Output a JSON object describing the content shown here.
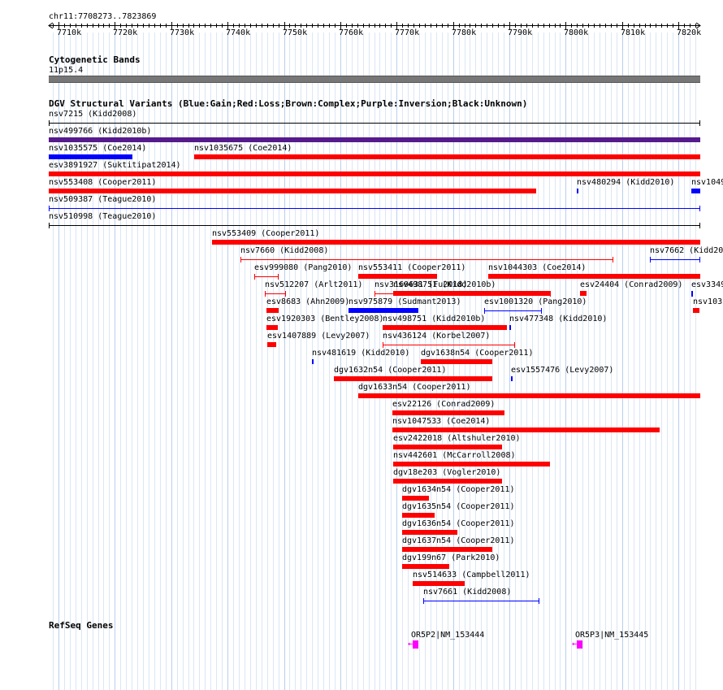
{
  "browser": {
    "region": "chr11:7708273..7823869",
    "axis_ticks": [
      "7710k",
      "7720k",
      "7730k",
      "7740k",
      "7750k",
      "7760k",
      "7770k",
      "7780k",
      "7790k",
      "7800k",
      "7810k",
      "7820k"
    ],
    "axis_start": 7708273,
    "axis_end": 7823869
  },
  "tracks": {
    "cytoband": {
      "title": "Cytogenetic Bands",
      "band": "11p15.4"
    },
    "dgv": {
      "title": "DGV Structural Variants (Blue:Gain;Red:Loss;Brown:Complex;Purple:Inversion;Black:Unknown)",
      "colors": {
        "gain": "#0000ff",
        "loss": "#ff0000",
        "complex": "#8b4513",
        "inversion": "#551a8b",
        "unknown": "#000000"
      },
      "features": [
        {
          "label": "nsv7215 (Kidd2008)",
          "start": 7708273,
          "end": 7823869,
          "type": "unknown",
          "style": "line",
          "row": 0
        },
        {
          "label": "nsv499766 (Kidd2010b)",
          "start": 7708273,
          "end": 7823869,
          "type": "inversion",
          "style": "bar",
          "row": 1
        },
        {
          "label": "nsv1035575 (Coe2014)",
          "start": 7708273,
          "end": 7723050,
          "type": "gain",
          "style": "bar",
          "row": 2
        },
        {
          "label": "nsv1035675 (Coe2014)",
          "start": 7734100,
          "end": 7823869,
          "type": "loss",
          "style": "bar",
          "row": 2
        },
        {
          "label": "esv3891927 (Suktitipat2014)",
          "start": 7708273,
          "end": 7823869,
          "type": "loss",
          "style": "bar",
          "row": 3
        },
        {
          "label": "nsv553408 (Cooper2011)",
          "start": 7708273,
          "end": 7794800,
          "type": "loss",
          "style": "bar",
          "row": 4
        },
        {
          "label": "nsv480294 (Kidd2010)",
          "start": 7801900,
          "end": 7802100,
          "type": "gain",
          "style": "bar",
          "row": 4
        },
        {
          "label": "nsv1049",
          "start": 7822300,
          "end": 7823869,
          "type": "gain",
          "style": "bar",
          "row": 4
        },
        {
          "label": "nsv509387 (Teague2010)",
          "start": 7708273,
          "end": 7823869,
          "type": "gain",
          "style": "line",
          "row": 5
        },
        {
          "label": "nsv510998 (Teague2010)",
          "start": 7708273,
          "end": 7823869,
          "type": "unknown",
          "style": "line",
          "row": 6
        },
        {
          "label": "nsv553409 (Cooper2011)",
          "start": 7737300,
          "end": 7823869,
          "type": "loss",
          "style": "bar",
          "row": 7
        },
        {
          "label": "nsv7660 (Kidd2008)",
          "start": 7742300,
          "end": 7808400,
          "type": "loss",
          "style": "line",
          "row": 8
        },
        {
          "label": "nsv7662 (Kidd20",
          "start": 7814900,
          "end": 7823869,
          "type": "gain",
          "style": "line",
          "row": 8
        },
        {
          "label": "esv999080 (Pang2010)",
          "start": 7744700,
          "end": 7749000,
          "type": "loss",
          "style": "line",
          "row": 9
        },
        {
          "label": "nsv553411 (Cooper2011)",
          "start": 7763200,
          "end": 7777200,
          "type": "loss",
          "style": "bar",
          "row": 9
        },
        {
          "label": "nsv1044303 (Coe2014)",
          "start": 7786200,
          "end": 7823869,
          "type": "loss",
          "style": "bar",
          "row": 9
        },
        {
          "label": "nsv512207 (Arlt2011)",
          "start": 7746600,
          "end": 7750300,
          "type": "loss",
          "style": "line",
          "row": 10
        },
        {
          "label": "nsv3169631 (Fu2018)",
          "start": 7766000,
          "end": 7797400,
          "type": "loss",
          "style": "line",
          "row": 10
        },
        {
          "label": "nsv498751 (Kidd2010b)",
          "start": 7769400,
          "end": 7797200,
          "type": "loss",
          "style": "bar",
          "row": 10
        },
        {
          "label": "esv24404 (Conrad2009)",
          "start": 7802500,
          "end": 7803700,
          "type": "loss",
          "style": "bar",
          "row": 10
        },
        {
          "label": "esv3349",
          "start": 7822300,
          "end": 7822500,
          "type": "gain",
          "style": "line",
          "row": 10
        },
        {
          "label": "esv8683 (Ahn2009)",
          "start": 7746900,
          "end": 7749000,
          "type": "loss",
          "style": "bar",
          "row": 11
        },
        {
          "label": "nsv975879 (Sudmant2013)",
          "start": 7761500,
          "end": 7773900,
          "type": "gain",
          "style": "bar",
          "row": 11
        },
        {
          "label": "esv1001320 (Pang2010)",
          "start": 7785600,
          "end": 7795700,
          "type": "gain",
          "style": "line",
          "row": 11
        },
        {
          "label": "nsv103",
          "start": 7822500,
          "end": 7823700,
          "type": "loss",
          "style": "bar",
          "row": 11
        },
        {
          "label": "esv1920303 (Bentley2008)",
          "start": 7746900,
          "end": 7748900,
          "type": "loss",
          "style": "bar",
          "row": 12
        },
        {
          "label": "nsv498751 (Kidd2010b)",
          "start": 7767500,
          "end": 7789500,
          "type": "loss",
          "style": "bar",
          "row": 12
        },
        {
          "label": "nsv477348 (Kidd2010)",
          "start": 7790000,
          "end": 7790200,
          "type": "gain",
          "style": "bar",
          "row": 12
        },
        {
          "label": "esv1407889 (Levy2007)",
          "start": 7747100,
          "end": 7748600,
          "type": "loss",
          "style": "bar",
          "row": 13
        },
        {
          "label": "nsv436124 (Korbel2007)",
          "start": 7767500,
          "end": 7791000,
          "type": "loss",
          "style": "line",
          "row": 13
        },
        {
          "label": "nsv481619 (Kidd2010)",
          "start": 7755000,
          "end": 7755200,
          "type": "gain",
          "style": "bar",
          "row": 14
        },
        {
          "label": "dgv1638n54 (Cooper2011)",
          "start": 7774300,
          "end": 7787000,
          "type": "loss",
          "style": "bar",
          "row": 14
        },
        {
          "label": "dgv1632n54 (Cooper2011)",
          "start": 7758900,
          "end": 7786900,
          "type": "loss",
          "style": "bar",
          "row": 15
        },
        {
          "label": "esv1557476 (Levy2007)",
          "start": 7790300,
          "end": 7790500,
          "type": "gain",
          "style": "bar",
          "row": 15
        },
        {
          "label": "dgv1633n54 (Cooper2011)",
          "start": 7763200,
          "end": 7823869,
          "type": "loss",
          "style": "bar",
          "row": 16
        },
        {
          "label": "esv22126 (Conrad2009)",
          "start": 7769200,
          "end": 7789100,
          "type": "loss",
          "style": "bar",
          "row": 17
        },
        {
          "label": "nsv1047533 (Coe2014)",
          "start": 7769200,
          "end": 7816700,
          "type": "loss",
          "style": "bar",
          "row": 18
        },
        {
          "label": "esv2422018 (Altshuler2010)",
          "start": 7769400,
          "end": 7788700,
          "type": "loss",
          "style": "bar",
          "row": 19
        },
        {
          "label": "nsv442601 (McCarroll2008)",
          "start": 7769400,
          "end": 7797200,
          "type": "loss",
          "style": "bar",
          "row": 20
        },
        {
          "label": "dgv18e203 (Vogler2010)",
          "start": 7769400,
          "end": 7788700,
          "type": "loss",
          "style": "bar",
          "row": 21
        },
        {
          "label": "dgv1634n54 (Cooper2011)",
          "start": 7771000,
          "end": 7775800,
          "type": "loss",
          "style": "bar",
          "row": 22
        },
        {
          "label": "dgv1635n54 (Cooper2011)",
          "start": 7771000,
          "end": 7776800,
          "type": "loss",
          "style": "bar",
          "row": 23
        },
        {
          "label": "dgv1636n54 (Cooper2011)",
          "start": 7771000,
          "end": 7780800,
          "type": "loss",
          "style": "bar",
          "row": 24
        },
        {
          "label": "dgv1637n54 (Cooper2011)",
          "start": 7771000,
          "end": 7786900,
          "type": "loss",
          "style": "bar",
          "row": 25
        },
        {
          "label": "dgv199n67 (Park2010)",
          "start": 7771000,
          "end": 7779400,
          "type": "loss",
          "style": "bar",
          "row": 26
        },
        {
          "label": "nsv514633 (Campbell2011)",
          "start": 7772800,
          "end": 7782000,
          "type": "loss",
          "style": "bar",
          "row": 27
        },
        {
          "label": "nsv7661 (Kidd2008)",
          "start": 7774700,
          "end": 7795400,
          "type": "gain",
          "style": "line",
          "row": 28
        }
      ]
    },
    "refseq": {
      "title": "RefSeq Genes",
      "genes": [
        {
          "label": "OR5P2|NM_153444",
          "start": 7772900,
          "end": 7773900,
          "strand": "-"
        },
        {
          "label": "OR5P3|NM_153445",
          "start": 7801900,
          "end": 7802900,
          "strand": "-"
        }
      ]
    }
  }
}
